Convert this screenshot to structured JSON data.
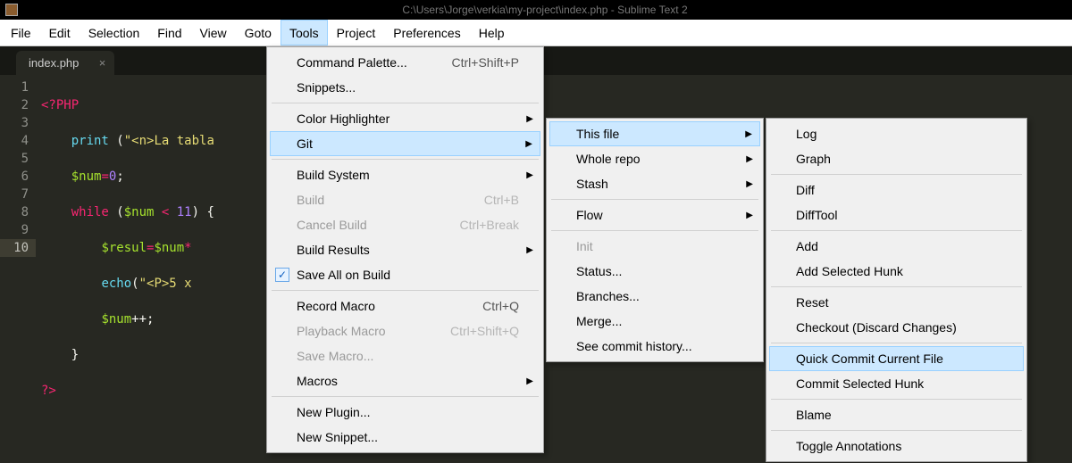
{
  "titlebar": {
    "path": "C:\\Users\\Jorge\\verkia\\my-project\\index.php - Sublime Text 2"
  },
  "menubar": {
    "items": [
      "File",
      "Edit",
      "Selection",
      "Find",
      "View",
      "Goto",
      "Tools",
      "Project",
      "Preferences",
      "Help"
    ],
    "active": "Tools"
  },
  "tab": {
    "name": "index.php",
    "close": "×"
  },
  "gutter": [
    "1",
    "2",
    "3",
    "4",
    "5",
    "6",
    "7",
    "8",
    "9",
    "10"
  ],
  "code": {
    "l1a": "<?PHP",
    "l2a": "print",
    "l2b": " (",
    "l2c": "\"<n>La tabla ",
    "l2d": "",
    "l3a": "$num",
    "l3b": "=",
    "l3c": "0",
    "l3d": ";",
    "l4a": "while",
    "l4b": " (",
    "l4c": "$num",
    "l4d": " < ",
    "l4e": "11",
    "l4f": ") {",
    "l5a": "$resul",
    "l5b": "=",
    "l5c": "$num",
    "l5d": "*",
    "l6a": "echo",
    "l6b": "(",
    "l6c": "\"<P>5 x",
    "l7a": "$num",
    "l7b": "++;",
    "l8a": "}",
    "l9a": "?>"
  },
  "menus": {
    "tools": {
      "command_palette": "Command Palette...",
      "command_palette_sc": "Ctrl+Shift+P",
      "snippets": "Snippets...",
      "color_highlighter": "Color Highlighter",
      "git": "Git",
      "build_system": "Build System",
      "build": "Build",
      "build_sc": "Ctrl+B",
      "cancel_build": "Cancel Build",
      "cancel_build_sc": "Ctrl+Break",
      "build_results": "Build Results",
      "save_all": "Save All on Build",
      "record_macro": "Record Macro",
      "record_macro_sc": "Ctrl+Q",
      "playback_macro": "Playback Macro",
      "playback_macro_sc": "Ctrl+Shift+Q",
      "save_macro": "Save Macro...",
      "macros": "Macros",
      "new_plugin": "New Plugin...",
      "new_snippet": "New Snippet..."
    },
    "git": {
      "this_file": "This file",
      "whole_repo": "Whole repo",
      "stash": "Stash",
      "flow": "Flow",
      "init": "Init",
      "status": "Status...",
      "branches": "Branches...",
      "merge": "Merge...",
      "see_history": "See commit history..."
    },
    "file": {
      "log": "Log",
      "graph": "Graph",
      "diff": "Diff",
      "difftool": "DiffTool",
      "add": "Add",
      "add_hunk": "Add Selected Hunk",
      "reset": "Reset",
      "checkout": "Checkout (Discard Changes)",
      "quick_commit": "Quick Commit Current File",
      "commit_hunk": "Commit Selected Hunk",
      "blame": "Blame",
      "toggle_annotations": "Toggle Annotations"
    }
  }
}
